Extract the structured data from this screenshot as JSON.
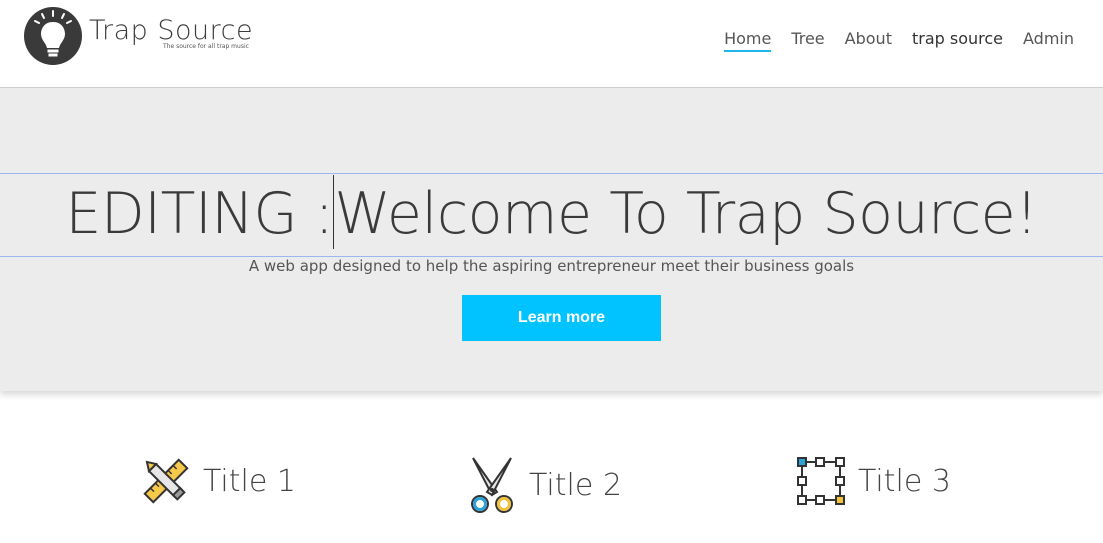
{
  "header": {
    "logo_name": "Trap Source",
    "logo_tagline": "The source for all trap music",
    "nav": [
      {
        "label": "Home",
        "active": true
      },
      {
        "label": "Tree"
      },
      {
        "label": "About"
      },
      {
        "label": "trap source",
        "bold": true
      },
      {
        "label": "Admin"
      }
    ]
  },
  "hero": {
    "title_prefix": "EDITING :",
    "title": "Welcome To Trap Source!",
    "subtitle": "A web app designed to help the aspiring entrepreneur meet their business goals",
    "button_label": "Learn more"
  },
  "features": [
    {
      "title": "Title 1",
      "icon": "ruler-pencil-icon"
    },
    {
      "title": "Title 2",
      "icon": "scissors-icon"
    },
    {
      "title": "Title 3",
      "icon": "selection-box-icon"
    }
  ],
  "colors": {
    "accent": "#00c3ff",
    "nav_underline": "#1fb5e8",
    "hero_bg": "#ececec",
    "edit_outline": "#9ab8ef"
  }
}
